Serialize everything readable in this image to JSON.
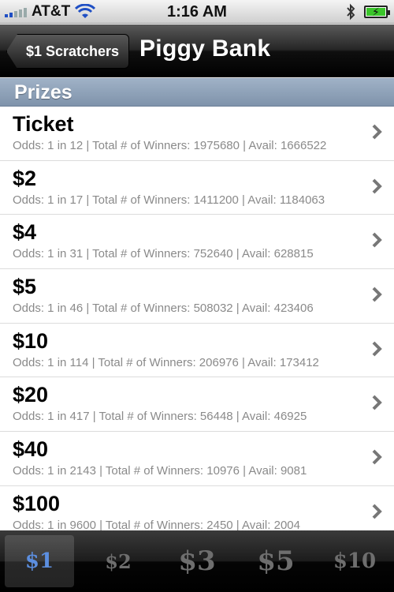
{
  "status_bar": {
    "carrier": "AT&T",
    "time": "1:16 AM",
    "signal_icon": "signal-bars-icon",
    "wifi_icon": "wifi-icon",
    "bluetooth_icon": "bluetooth-icon",
    "battery_icon": "battery-charging-icon"
  },
  "nav": {
    "back_label": "$1 Scratchers",
    "title": "Piggy Bank"
  },
  "section": {
    "title": "Prizes"
  },
  "prizes": [
    {
      "title": "Ticket",
      "detail": "Odds: 1 in 12 | Total # of Winners: 1975680 | Avail: 1666522"
    },
    {
      "title": "$2",
      "detail": "Odds: 1 in 17 | Total # of Winners: 1411200 | Avail: 1184063"
    },
    {
      "title": "$4",
      "detail": "Odds: 1 in 31 | Total # of Winners: 752640 | Avail: 628815"
    },
    {
      "title": "$5",
      "detail": "Odds: 1 in 46 | Total # of Winners: 508032 | Avail: 423406"
    },
    {
      "title": "$10",
      "detail": "Odds: 1 in 114 | Total # of Winners: 206976 | Avail: 173412"
    },
    {
      "title": "$20",
      "detail": "Odds: 1 in 417 | Total # of Winners: 56448 | Avail: 46925"
    },
    {
      "title": "$40",
      "detail": "Odds: 1 in 2143 | Total # of Winners: 10976 | Avail: 9081"
    },
    {
      "title": "$100",
      "detail": "Odds: 1 in 9600 | Total # of Winners: 2450 | Avail: 2004"
    }
  ],
  "tabs": [
    {
      "label": "$1",
      "selected": true
    },
    {
      "label": "$2",
      "selected": false
    },
    {
      "label": "$3",
      "selected": false
    },
    {
      "label": "$5",
      "selected": false
    },
    {
      "label": "$10",
      "selected": false
    }
  ],
  "colors": {
    "tab_selected": "#5c8fe0",
    "tab_inactive": "#6e6e6e",
    "section_header": "#8fa2b9",
    "detail_text": "#8a8a8a"
  }
}
